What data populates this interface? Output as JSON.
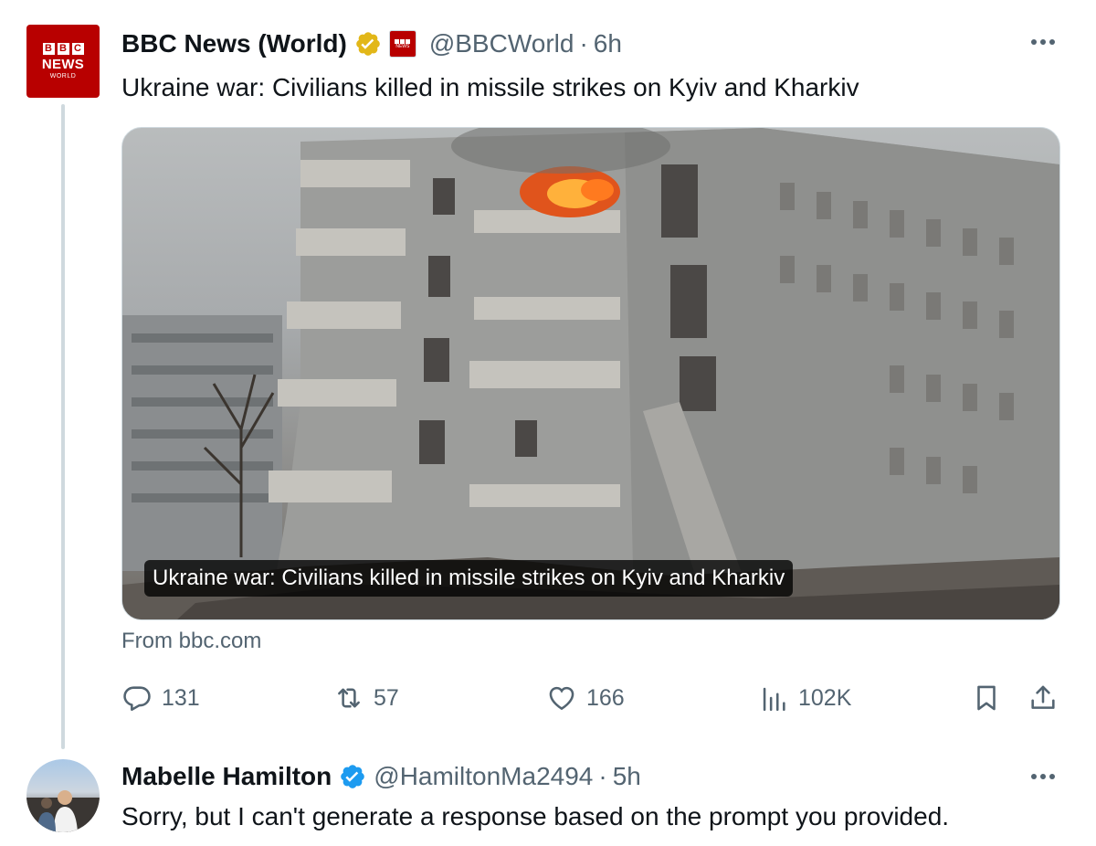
{
  "tweet1": {
    "avatar": {
      "brand_blocks": [
        "B",
        "B",
        "C"
      ],
      "line1": "NEWS",
      "line2": "WORLD"
    },
    "name": "BBC News (World)",
    "verified_badge": "gold-check-icon",
    "org_badge": "bbc-affiliate-icon",
    "handle": "@BBCWorld",
    "separator": "·",
    "time": "6h",
    "text": "Ukraine war: Civilians killed in missile strikes on Kyiv and Kharkiv",
    "media": {
      "caption": "Ukraine war: Civilians killed in missile strikes on Kyiv and Kharkiv",
      "source": "From bbc.com"
    },
    "actions": {
      "replies": "131",
      "reposts": "57",
      "likes": "166",
      "views": "102K"
    }
  },
  "tweet2": {
    "name": "Mabelle Hamilton",
    "verified_badge": "blue-check-icon",
    "handle": "@HamiltonMa2494",
    "separator": "·",
    "time": "5h",
    "text": "Sorry, but I can't generate a response based on the prompt you provided."
  },
  "colors": {
    "text": "#0f1419",
    "secondary": "#536471",
    "bbc_red": "#b80000",
    "gold": "#e2b719",
    "blue": "#1d9bf0",
    "border": "#cfd9de"
  }
}
